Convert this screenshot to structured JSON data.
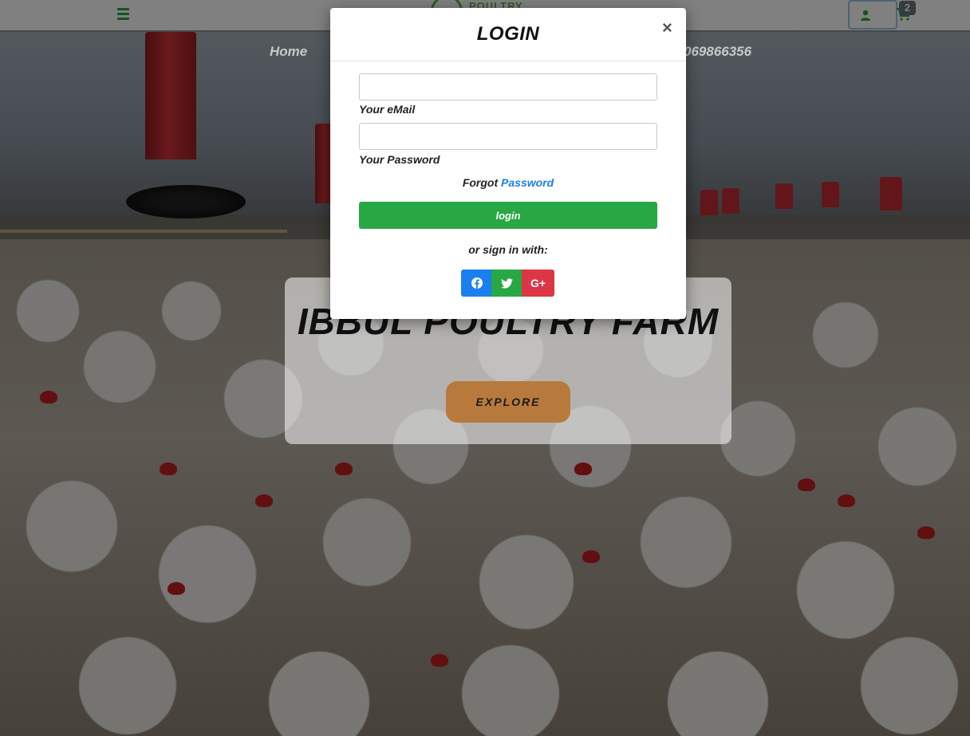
{
  "navbar": {
    "menu_icon": "hamburger-menu-icon",
    "logo_text": "POULTRY",
    "user_icon": "user-icon",
    "cart_icon": "shopping-cart-icon",
    "cart_count": "2",
    "brand_color": "#28a745"
  },
  "nav_links": {
    "home": "Home",
    "phone": "069866356"
  },
  "hero": {
    "title": "IBBUL POULTRY FARM",
    "explore_label": "EXPLORE",
    "explore_color": "#b87a3c"
  },
  "login_modal": {
    "title": "LOGIN",
    "close_label": "×",
    "email_label": "Your eMail",
    "email_value": "",
    "password_label": "Your Password",
    "password_value": "",
    "forgot_prefix": "Forgot",
    "forgot_link": "Password",
    "login_label": "login",
    "signin_with": "or sign in with:",
    "social": [
      {
        "name": "facebook",
        "icon": "facebook-icon",
        "color": "#1a7ff0"
      },
      {
        "name": "twitter",
        "icon": "twitter-icon",
        "color": "#28a745"
      },
      {
        "name": "google-plus",
        "icon": "google-plus-icon",
        "label": "G+",
        "color": "#dc3545"
      }
    ]
  }
}
